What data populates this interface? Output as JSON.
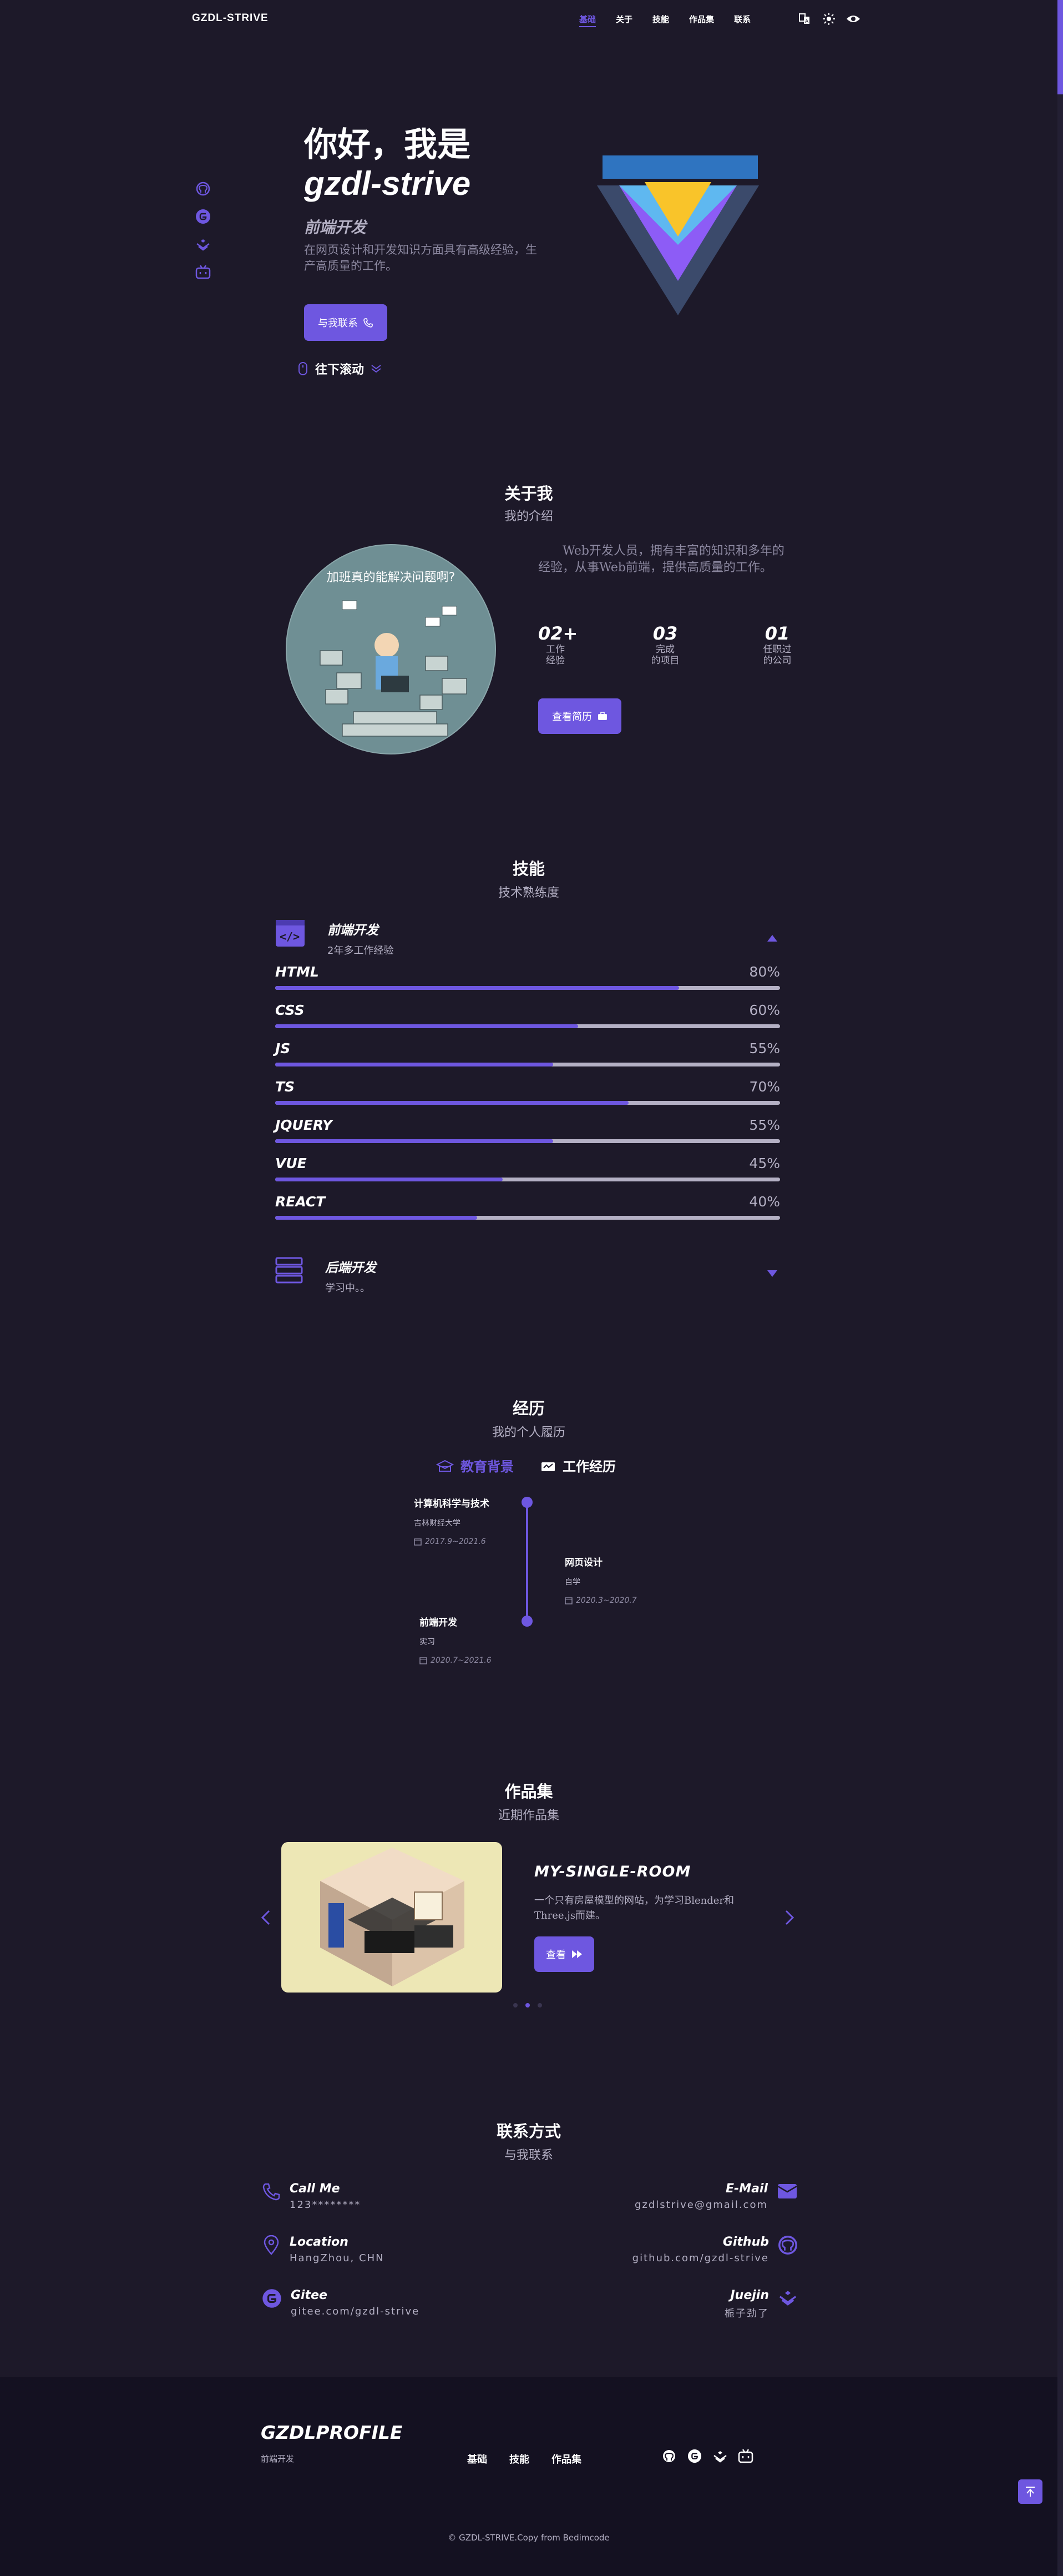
{
  "nav": {
    "logo": "GZDL-STRIVE",
    "links": [
      "基础",
      "关于",
      "技能",
      "作品集",
      "联系"
    ],
    "icons": [
      "language-icon",
      "sun-icon",
      "eye-icon"
    ]
  },
  "hero": {
    "title_line1": "你好，我是",
    "title_line2": "gzdl-strive",
    "subtitle": "前端开发",
    "description": "在网页设计和开发知识方面具有高级经验，生产高质量的工作。",
    "contact_button": "与我联系",
    "scroll_down": "往下滚动",
    "social_icons": [
      "github-icon",
      "gitee-icon",
      "juejin-icon",
      "bilibili-icon"
    ]
  },
  "about": {
    "title": "关于我",
    "subtitle": "我的介绍",
    "image_caption": "加班真的能解决问题啊?",
    "description": "Web开发人员，拥有丰富的知识和多年的经验，从事Web前端，提供高质量的工作。",
    "stats": [
      {
        "number": "02+",
        "label_line1": "工作",
        "label_line2": "经验"
      },
      {
        "number": "03",
        "label_line1": "完成",
        "label_line2": "的项目"
      },
      {
        "number": "01",
        "label_line1": "任职过",
        "label_line2": "的公司"
      }
    ],
    "resume_button": "查看简历"
  },
  "skills": {
    "title": "技能",
    "subtitle": "技术熟练度",
    "frontend": {
      "title": "前端开发",
      "subtitle": "2年多工作经验",
      "items": [
        {
          "name": "HTML",
          "percent": "80%",
          "value": 0.8
        },
        {
          "name": "CSS",
          "percent": "60%",
          "value": 0.6
        },
        {
          "name": "JS",
          "percent": "55%",
          "value": 0.55
        },
        {
          "name": "TS",
          "percent": "70%",
          "value": 0.7
        },
        {
          "name": "JQUERY",
          "percent": "55%",
          "value": 0.55
        },
        {
          "name": "VUE",
          "percent": "45%",
          "value": 0.45
        },
        {
          "name": "REACT",
          "percent": "40%",
          "value": 0.4
        }
      ]
    },
    "backend": {
      "title": "后端开发",
      "subtitle": "学习中。。"
    }
  },
  "qualification": {
    "title": "经历",
    "subtitle": "我的个人履历",
    "tabs": [
      "教育背景",
      "工作经历"
    ],
    "items": [
      {
        "title": "计算机科学与技术",
        "subtitle": "吉林财经大学",
        "date": "2017.9~2021.6"
      },
      {
        "title": "网页设计",
        "subtitle": "自学",
        "date": "2020.3~2020.7"
      },
      {
        "title": "前端开发",
        "subtitle": "实习",
        "date": "2020.7~2021.6"
      }
    ]
  },
  "portfolio": {
    "title": "作品集",
    "subtitle": "近期作品集",
    "project_title": "MY-SINGLE-ROOM",
    "project_desc": "一个只有房屋模型的网站，为学习Blender和Three.js而建。",
    "view_button": "查看",
    "active_slide": 2,
    "slide_count": 3
  },
  "contact": {
    "title": "联系方式",
    "subtitle": "与我联系",
    "items": [
      {
        "title": "Call Me",
        "value": "123********"
      },
      {
        "title": "E-Mail",
        "value": "gzdlstrive@gmail.com"
      },
      {
        "title": "Location",
        "value": "HangZhou, CHN"
      },
      {
        "title": "Github",
        "value": "github.com/gzdl-strive"
      },
      {
        "title": "Gitee",
        "value": "gitee.com/gzdl-strive"
      },
      {
        "title": "Juejin",
        "value": "栀子劲了"
      }
    ]
  },
  "footer": {
    "logo": "GZDLPROFILE",
    "subtitle": "前端开发",
    "links": [
      "基础",
      "技能",
      "作品集"
    ],
    "copyright": "© GZDL-STRIVE.Copy from Bedimcode"
  },
  "colors": {
    "background": "#1d1929",
    "accent": "#6e57e0",
    "footer": "#141121"
  }
}
